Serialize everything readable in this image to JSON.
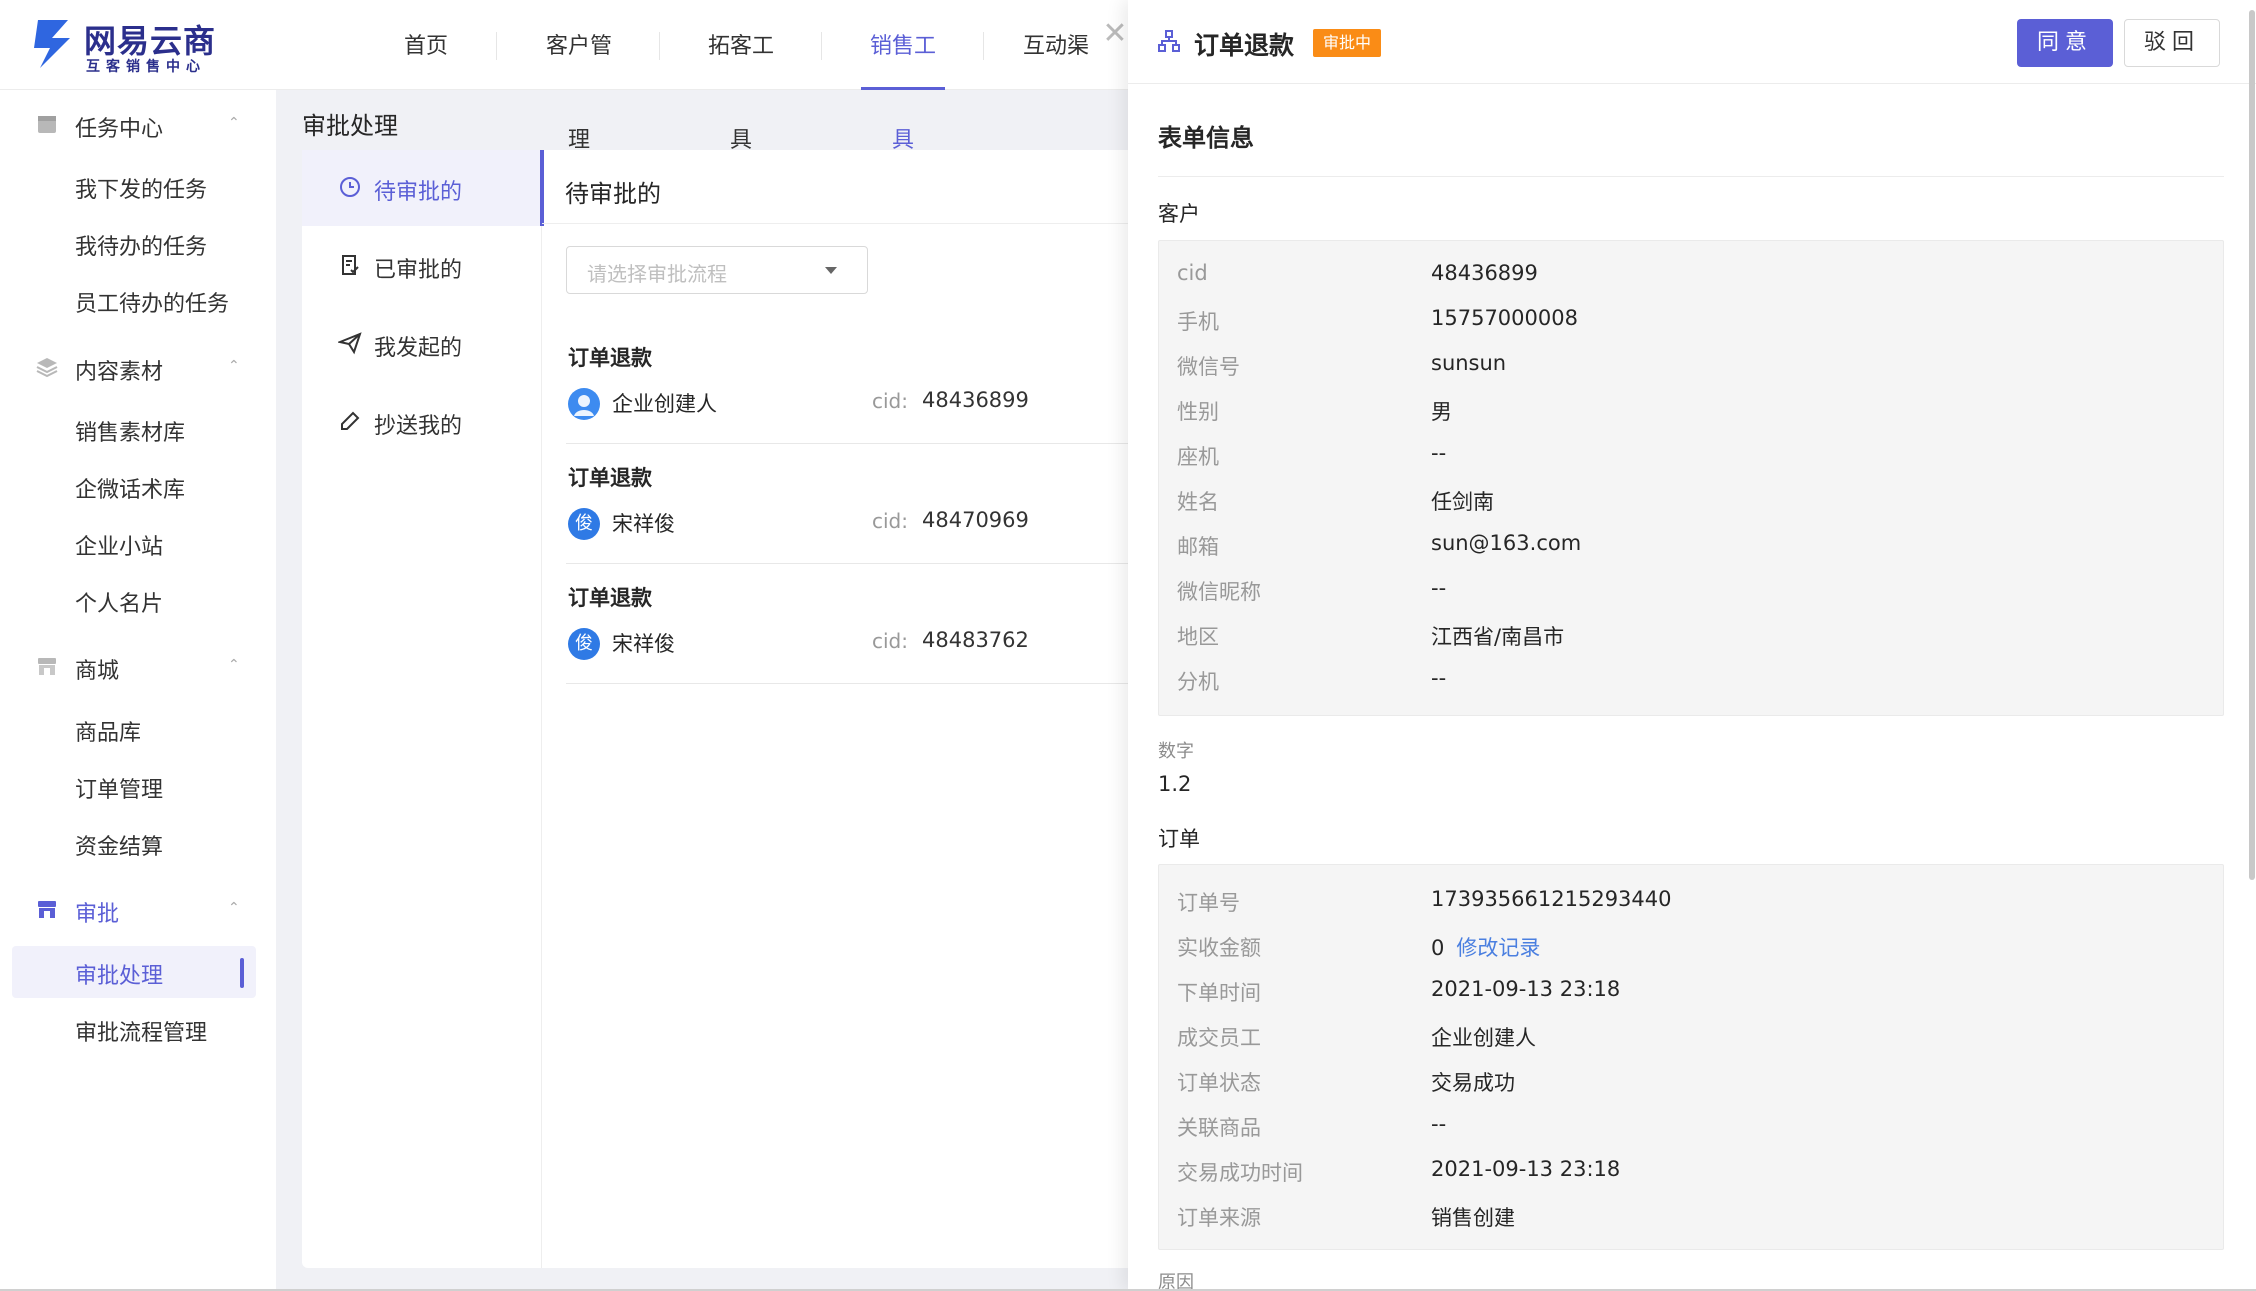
{
  "logo": {
    "title": "网易云商",
    "subtitle": "互客销售中心"
  },
  "nav": [
    {
      "label": "首页"
    },
    {
      "label": "客户管理"
    },
    {
      "label": "拓客工具"
    },
    {
      "label": "销售工具"
    },
    {
      "label": "互动渠道"
    }
  ],
  "sidebar": {
    "groups": [
      {
        "label": "任务中心",
        "items": [
          "我下发的任务",
          "我待办的任务",
          "员工待办的任务"
        ]
      },
      {
        "label": "内容素材",
        "items": [
          "销售素材库",
          "企微话术库",
          "企业小站",
          "个人名片"
        ]
      },
      {
        "label": "商城",
        "items": [
          "商品库",
          "订单管理",
          "资金结算"
        ]
      },
      {
        "label": "审批",
        "items": [
          "审批处理",
          "审批流程管理"
        ]
      }
    ]
  },
  "main": {
    "page_title": "审批处理",
    "tabs": [
      {
        "label": "待审批的"
      },
      {
        "label": "已审批的"
      },
      {
        "label": "我发起的"
      },
      {
        "label": "抄送我的"
      }
    ],
    "list_title": "待审批的",
    "select_placeholder": "请选择审批流程",
    "items": [
      {
        "title": "订单退款",
        "avatar": "",
        "person": "企业创建人",
        "cid_label": "cid:",
        "cid": "48436899"
      },
      {
        "title": "订单退款",
        "avatar": "俊",
        "person": "宋祥俊",
        "cid_label": "cid:",
        "cid": "48470969"
      },
      {
        "title": "订单退款",
        "avatar": "俊",
        "person": "宋祥俊",
        "cid_label": "cid:",
        "cid": "48483762"
      }
    ]
  },
  "drawer": {
    "close_glyph": "✕",
    "title": "订单退款",
    "badge": "审批中",
    "agree_label": "同意",
    "reject_label": "驳回",
    "section_title": "表单信息",
    "customer_label": "客户",
    "customer": [
      {
        "k": "cid",
        "v": "48436899"
      },
      {
        "k": "手机",
        "v": "15757000008"
      },
      {
        "k": "微信号",
        "v": "sunsun"
      },
      {
        "k": "性别",
        "v": "男"
      },
      {
        "k": "座机",
        "v": "--"
      },
      {
        "k": "姓名",
        "v": "任剑南"
      },
      {
        "k": "邮箱",
        "v": "sun@163.com"
      },
      {
        "k": "微信昵称",
        "v": "--"
      },
      {
        "k": "地区",
        "v": "江西省/南昌市"
      },
      {
        "k": "分机",
        "v": "--"
      }
    ],
    "number_label": "数字",
    "number_value": "1.2",
    "order_label": "订单",
    "order": [
      {
        "k": "订单号",
        "v": "173935661215293440"
      },
      {
        "k": "实收金额",
        "v": "0",
        "link": "修改记录"
      },
      {
        "k": "下单时间",
        "v": "2021-09-13 23:18"
      },
      {
        "k": "成交员工",
        "v": "企业创建人"
      },
      {
        "k": "订单状态",
        "v": "交易成功"
      },
      {
        "k": "关联商品",
        "v": "--"
      },
      {
        "k": "交易成功时间",
        "v": "2021-09-13 23:18"
      },
      {
        "k": "订单来源",
        "v": "销售创建"
      }
    ],
    "reason_label": "原因"
  },
  "colors": {
    "accent": "#5b5fd6",
    "badge": "#fa8c16",
    "link": "#4a7fe0"
  }
}
